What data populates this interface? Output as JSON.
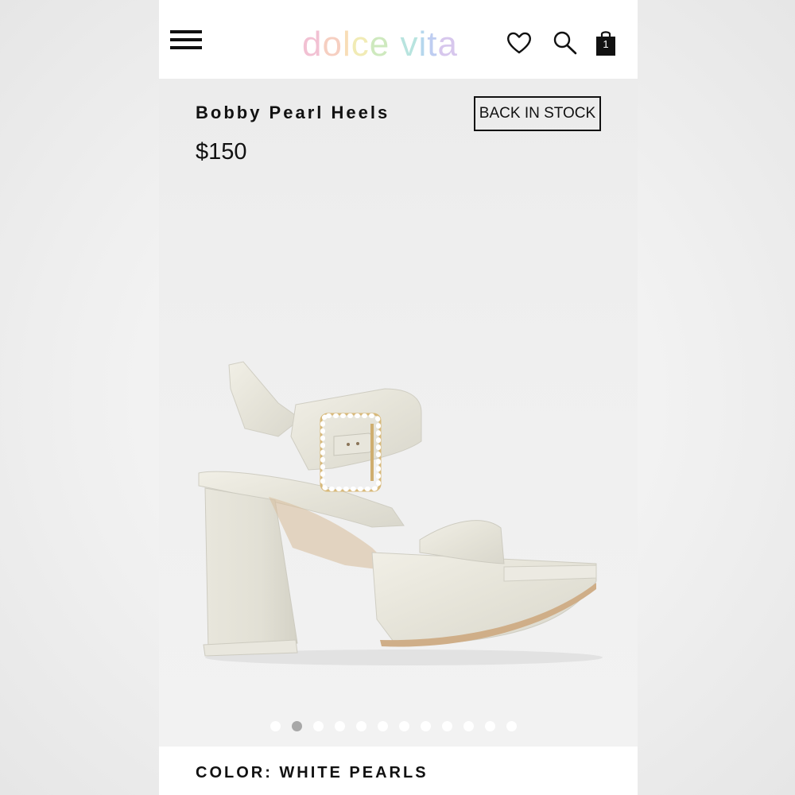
{
  "header": {
    "logo_letters": [
      {
        "char": "d",
        "color": "#e88fb0"
      },
      {
        "char": "o",
        "color": "#f0a890"
      },
      {
        "char": "l",
        "color": "#f4c27e"
      },
      {
        "char": "c",
        "color": "#e6dc7a"
      },
      {
        "char": "e",
        "color": "#a7d88a"
      },
      {
        "char": " ",
        "color": "#ffffff"
      },
      {
        "char": "v",
        "color": "#7fcfc6"
      },
      {
        "char": "i",
        "color": "#7ab8e0"
      },
      {
        "char": "t",
        "color": "#8aa6e6"
      },
      {
        "char": "a",
        "color": "#b79ae0"
      }
    ],
    "icons": [
      "hamburger-menu-icon",
      "heart-icon",
      "search-icon",
      "shopping-bag-icon"
    ],
    "cart_count": "1"
  },
  "product": {
    "title": "Bobby Pearl Heels",
    "price": "$150",
    "badge": "BACK IN STOCK",
    "image_count": 12,
    "active_image_index": 1
  },
  "footer": {
    "color_label": "COLOR: WHITE PEARLS"
  },
  "colors": {
    "header_bg": "#ffffff",
    "page_bg": "#efefef",
    "text": "#111111",
    "dot_inactive": "#ffffff",
    "dot_active": "#a8a8a8"
  }
}
